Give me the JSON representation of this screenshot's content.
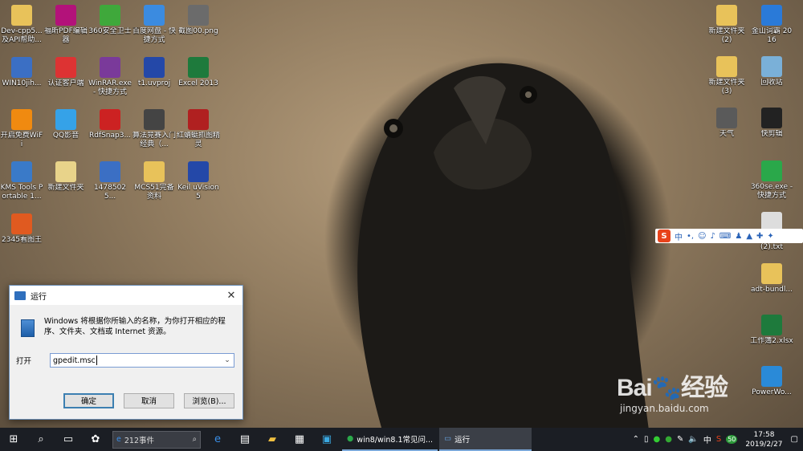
{
  "desktop_left": [
    {
      "label": "Dev-cpp5...\n及API帮助...",
      "icon": "folder-icon",
      "color": "#e8c25a"
    },
    {
      "label": "福昕PDF编辑器",
      "icon": "foxit-icon",
      "color": "#b3127a"
    },
    {
      "label": "360安全卫士",
      "icon": "shield-icon",
      "color": "#3fa83b"
    },
    {
      "label": "百度网盘 - 快捷方式",
      "icon": "cloud-icon",
      "color": "#3b8be0"
    },
    {
      "label": "截图00.png",
      "icon": "image-icon",
      "color": "#6b6b6b"
    },
    {
      "label": "WIN10jih...",
      "icon": "archive-icon",
      "color": "#3b6fc4"
    },
    {
      "label": "认证客户端",
      "icon": "client-icon",
      "color": "#d33"
    },
    {
      "label": "WinRAR.exe - 快捷方式",
      "icon": "winrar-icon",
      "color": "#7a3a9a"
    },
    {
      "label": "t1.uvproj",
      "icon": "keil-icon",
      "color": "#2448a8"
    },
    {
      "label": "Excel 2013",
      "icon": "excel-icon",
      "color": "#1e7a3c"
    },
    {
      "label": "开启免费WiFi",
      "icon": "wifi-icon",
      "color": "#f08a10"
    },
    {
      "label": "QQ影音",
      "icon": "qq-player-icon",
      "color": "#35a2e8"
    },
    {
      "label": "RdfSnap3...",
      "icon": "snap-icon",
      "color": "#c22"
    },
    {
      "label": "算法竞赛入门经典（...",
      "icon": "book-icon",
      "color": "#444"
    },
    {
      "label": "红蜻蜓抓图精灵",
      "icon": "dragonfly-icon",
      "color": "#b02020"
    },
    {
      "label": "KMS Tools Portable 1...",
      "icon": "kms-icon",
      "color": "#3a7ac8"
    },
    {
      "label": "新建文件夹",
      "icon": "folder-icon",
      "color": "#e8d38a"
    },
    {
      "label": "14785025...",
      "icon": "archive-icon",
      "color": "#3b6fc4"
    },
    {
      "label": "MCS51完备资料",
      "icon": "folder-icon",
      "color": "#e8c25a"
    },
    {
      "label": "Keil uVision5",
      "icon": "keil-icon",
      "color": "#2448a8"
    },
    {
      "label": "2345看图王",
      "icon": "viewer-icon",
      "color": "#e05a20"
    }
  ],
  "desktop_right": [
    {
      "label": "新建文件夹 (2)",
      "icon": "folder-icon",
      "color": "#e8c25a"
    },
    {
      "label": "金山词霸 2016",
      "icon": "dict-icon",
      "color": "#2a7ad8"
    },
    {
      "label": "新建文件夹 (3)",
      "icon": "folder-icon",
      "color": "#e8c25a"
    },
    {
      "label": "回收站",
      "icon": "recycle-bin-icon",
      "color": "#7ab0d8"
    },
    {
      "label": "天气",
      "icon": "weather-icon",
      "color": "#5a5a5a"
    },
    {
      "label": "快剪辑",
      "icon": "clip-icon",
      "color": "#222"
    },
    {
      "label": "360se.exe - 快捷方式",
      "icon": "browser-icon",
      "color": "#2aa84a"
    },
    {
      "label": "本文文档 (2).txt",
      "icon": "text-file-icon",
      "color": "#ddd"
    },
    {
      "label": "adt-bundl...",
      "icon": "folder-icon",
      "color": "#e8c25a"
    },
    {
      "label": "工作簿2.xlsx",
      "icon": "excel-icon",
      "color": "#1e7a3c"
    },
    {
      "label": "PowerWo...",
      "icon": "cube-icon",
      "color": "#2a8ad8"
    }
  ],
  "run_dialog": {
    "title": "运行",
    "description": "Windows 将根据你所输入的名称，为你打开相应的程序、文件夹、文档或 Internet 资源。",
    "open_label": "打开",
    "input_value": "gpedit.msc",
    "ok": "确定",
    "cancel": "取消",
    "browse": "浏览(B)..."
  },
  "ime_bar": {
    "brand": "S",
    "mode": "中"
  },
  "taskbar": {
    "search_text": "212事件",
    "tasks": [
      {
        "label": "win8/win8.1常见问..."
      },
      {
        "label": "运行"
      }
    ],
    "tray_lang": "中",
    "time": "17:58",
    "date": "2019/2/27",
    "badge": "50"
  },
  "watermark": {
    "brand": "Bai",
    "brand2": "经验",
    "url": "jingyan.baidu.com"
  }
}
